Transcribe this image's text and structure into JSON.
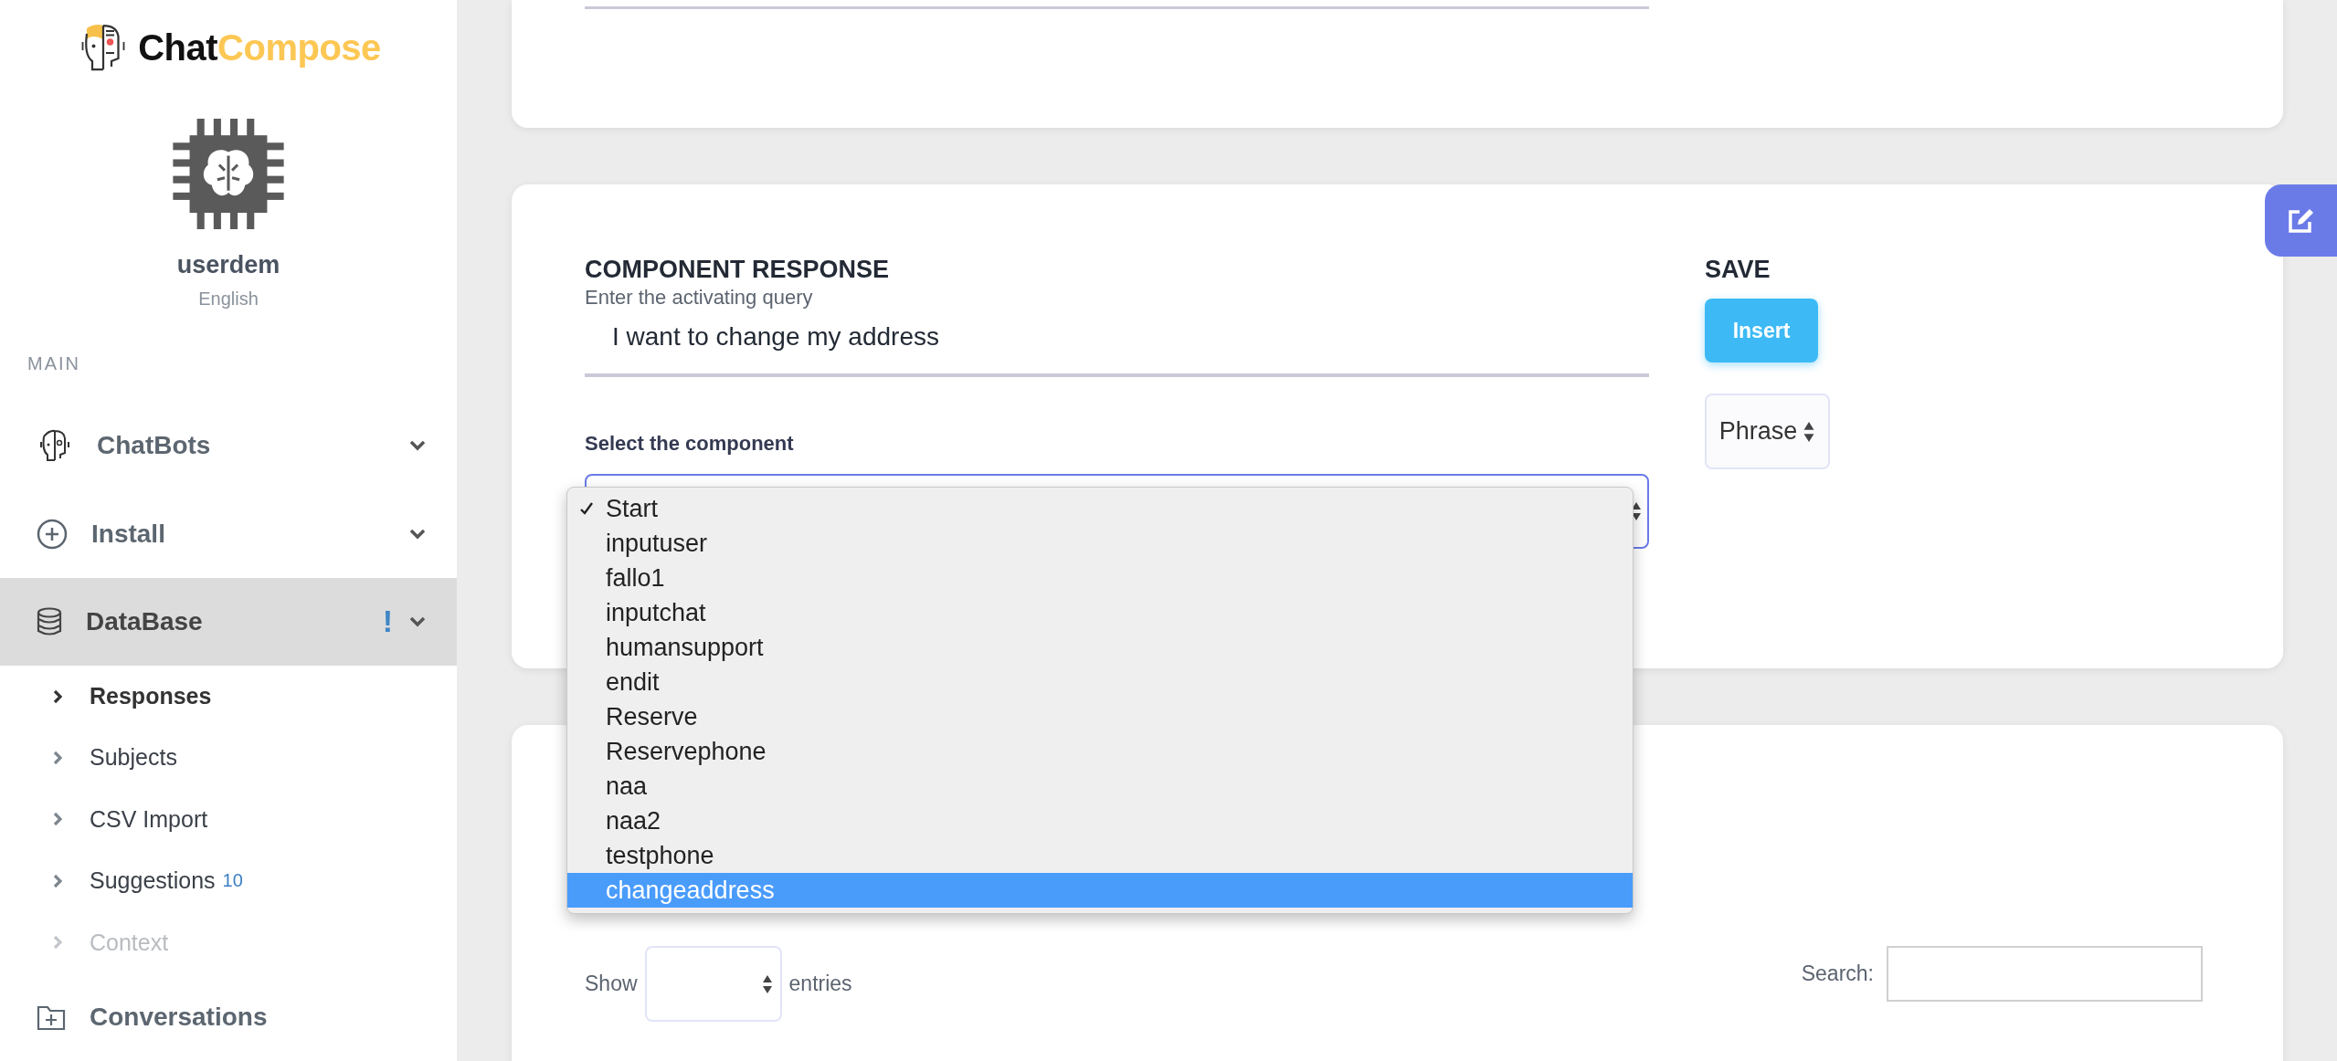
{
  "sidebar": {
    "logo": {
      "part_1": "Chat",
      "part_2": "Compose"
    },
    "user": {
      "name": "userdem",
      "language": "English"
    },
    "section_label": "MAIN",
    "menu": [
      {
        "label": "ChatBots",
        "kind": "bot",
        "expandable": true,
        "expanded": false
      },
      {
        "label": "Install",
        "kind": "install",
        "expandable": true,
        "expanded": false
      },
      {
        "label": "DataBase",
        "kind": "database",
        "expandable": true,
        "expanded": true,
        "alert": "!",
        "children": [
          {
            "label": "Responses",
            "selected": true,
            "disabled": false
          },
          {
            "label": "Subjects",
            "selected": false,
            "disabled": false
          },
          {
            "label": "CSV Import",
            "selected": false,
            "disabled": false
          },
          {
            "label": "Suggestions",
            "selected": false,
            "disabled": false,
            "count": "10"
          },
          {
            "label": "Context",
            "selected": false,
            "disabled": true
          }
        ]
      },
      {
        "label": "Conversations",
        "kind": "conversations",
        "expandable": false,
        "expanded": false
      }
    ]
  },
  "form": {
    "title": "COMPONENT RESPONSE",
    "query_label": "Enter the activating query",
    "query_value": "I want to change my address",
    "component_label": "Select the component",
    "component_options": [
      {
        "label": "Start",
        "selected": true,
        "highlighted": false
      },
      {
        "label": "inputuser",
        "selected": false,
        "highlighted": false
      },
      {
        "label": "fallo1",
        "selected": false,
        "highlighted": false
      },
      {
        "label": "inputchat",
        "selected": false,
        "highlighted": false
      },
      {
        "label": "humansupport",
        "selected": false,
        "highlighted": false
      },
      {
        "label": "endit",
        "selected": false,
        "highlighted": false
      },
      {
        "label": "Reserve",
        "selected": false,
        "highlighted": false
      },
      {
        "label": "Reservephone",
        "selected": false,
        "highlighted": false
      },
      {
        "label": "naa",
        "selected": false,
        "highlighted": false
      },
      {
        "label": "naa2",
        "selected": false,
        "highlighted": false
      },
      {
        "label": "testphone",
        "selected": false,
        "highlighted": false
      },
      {
        "label": "changeaddress",
        "selected": false,
        "highlighted": true
      }
    ],
    "save_title": "SAVE",
    "insert_button": "Insert",
    "type_select": "Phrase"
  },
  "table_controls": {
    "show_label": "Show",
    "entries_label": "entries",
    "search_label": "Search:"
  }
}
